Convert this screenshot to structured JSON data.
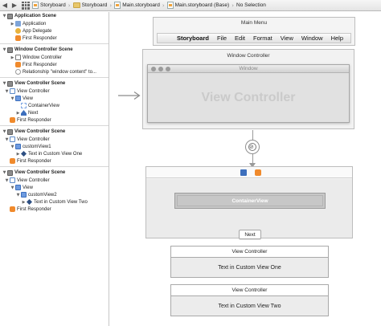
{
  "jumpbar": {
    "crumbs": [
      "Storyboard",
      "Storyboard",
      "Main.storyboard",
      "Main.storyboard (Base)",
      "No Selection"
    ]
  },
  "outline": {
    "application_scene": {
      "title": "Application Scene",
      "items": [
        "Application",
        "App Delegate",
        "First Responder"
      ]
    },
    "window_controller_scene": {
      "title": "Window Controller Scene",
      "items": [
        "Window Controller",
        "First Responder",
        "Relationship \"window content\" to..."
      ]
    },
    "view_controller_scene_1": {
      "title": "View Controller Scene",
      "items": [
        "View Controller",
        "View",
        "ContainerView",
        "Next",
        "First Responder"
      ]
    },
    "view_controller_scene_2": {
      "title": "View Controller Scene",
      "items": [
        "View Controller",
        "customView1",
        "Text in Custom View One",
        "First Responder"
      ]
    },
    "view_controller_scene_3": {
      "title": "View Controller Scene",
      "items": [
        "View Controller",
        "View",
        "customView2",
        "Text in Custom View Two",
        "First Responder"
      ]
    }
  },
  "canvas": {
    "main_menu": {
      "title": "Main Menu",
      "items": [
        "Storyboard",
        "File",
        "Edit",
        "Format",
        "View",
        "Window",
        "Help"
      ]
    },
    "window_controller": {
      "title": "Window Controller",
      "window_title": "Window",
      "content_label": "View Controller"
    },
    "view_controller": {
      "container_label": "ContainerView",
      "next_label": "Next"
    },
    "custom_view_one": {
      "title": "View Controller",
      "text": "Text in Custom View One"
    },
    "custom_view_two": {
      "title": "View Controller",
      "text": "Text in Custom View Two"
    }
  },
  "colors": {
    "accent": "#3d6fbd",
    "responder": "#f08a2c"
  }
}
